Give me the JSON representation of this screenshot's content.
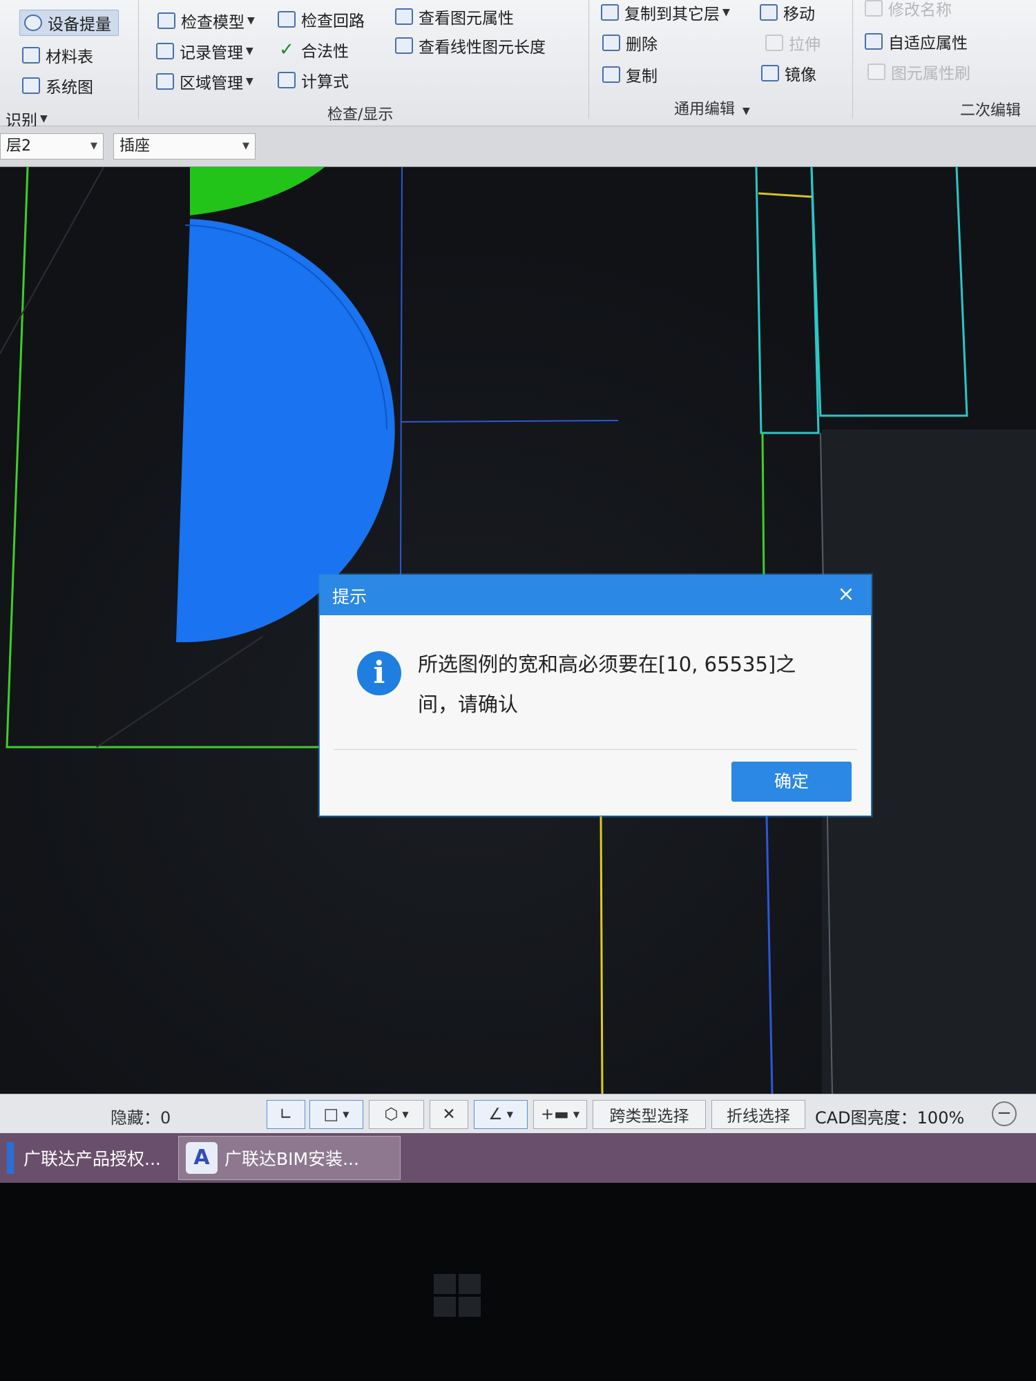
{
  "ribbon": {
    "col1": {
      "equipment_takeoff": "设备提量",
      "material_table": "材料表",
      "system_diagram": "系统图",
      "identify_group": "识别"
    },
    "col2": {
      "check_model": "检查模型",
      "record_management": "记录管理",
      "area_management": "区域管理"
    },
    "col3": {
      "check_circuit": "检查回路",
      "legality": "合法性",
      "formula": "计算式"
    },
    "col4": {
      "view_element_properties": "查看图元属性",
      "view_linear_length": "查看线性图元长度"
    },
    "check_display_group": "检查/显示",
    "col5": {
      "copy_to_other_layer": "复制到其它层",
      "delete": "删除",
      "copy": "复制"
    },
    "col6": {
      "move": "移动",
      "stretch": "拉伸",
      "mirror": "镜像"
    },
    "general_edit_group": "通用编辑",
    "col7": {
      "rename": "修改名称",
      "adaptive_properties": "自适应属性",
      "element_property_brush": "图元属性刷"
    },
    "secondary_edit_group": "二次编辑"
  },
  "combobar": {
    "layer": "层2",
    "component_type": "插座"
  },
  "dialog": {
    "title": "提示",
    "close": "×",
    "info_glyph": "i",
    "message": "所选图例的宽和高必须要在[10, 65535]之间，请确认",
    "ok": "确定"
  },
  "statusbar": {
    "hidden": "隐藏：0",
    "cross_type_select": "跨类型选择",
    "polyline_select": "折线选择",
    "cad_brightness": "CAD图亮度：100%",
    "zoom_out": "−"
  },
  "taskbar": {
    "task1": "广联达产品授权...",
    "task2": "广联达BIM安装...",
    "task2_icon_glyph": "A"
  },
  "colors": {
    "accent_blue": "#2b88e4",
    "cad_background": "#14171b",
    "shape_blue": "#1a73f0",
    "shape_green": "#22c41a"
  }
}
